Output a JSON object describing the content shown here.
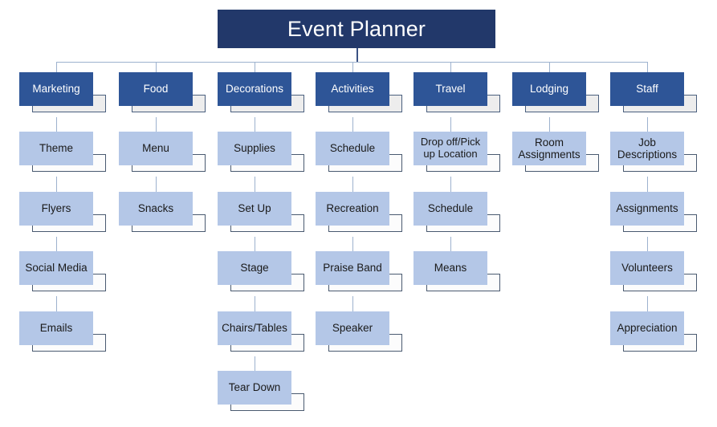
{
  "chart": {
    "type": "org-chart",
    "title": "Event Planner",
    "title_color": "#22386A",
    "level1_color": "#2E5597",
    "level2_color": "#B4C7E7",
    "connector_color": "#9DB2CE"
  },
  "root": {
    "label": "Event Planner"
  },
  "columns": [
    {
      "head": "Marketing",
      "children": [
        "Theme",
        "Flyers",
        "Social Media",
        "Emails"
      ]
    },
    {
      "head": "Food",
      "children": [
        "Menu",
        "Snacks"
      ]
    },
    {
      "head": "Decorations",
      "children": [
        "Supplies",
        "Set Up",
        "Stage",
        "Chairs/Tables",
        "Tear Down"
      ]
    },
    {
      "head": "Activities",
      "children": [
        "Schedule",
        "Recreation",
        "Praise Band",
        "Speaker"
      ]
    },
    {
      "head": "Travel",
      "children": [
        "Drop off/Pick up Location",
        "Schedule",
        "Means"
      ]
    },
    {
      "head": "Lodging",
      "children": [
        "Room Assignments"
      ]
    },
    {
      "head": "Staff",
      "children": [
        "Job Descriptions",
        "Assignments",
        "Volunteers",
        "Appreciation"
      ]
    }
  ]
}
